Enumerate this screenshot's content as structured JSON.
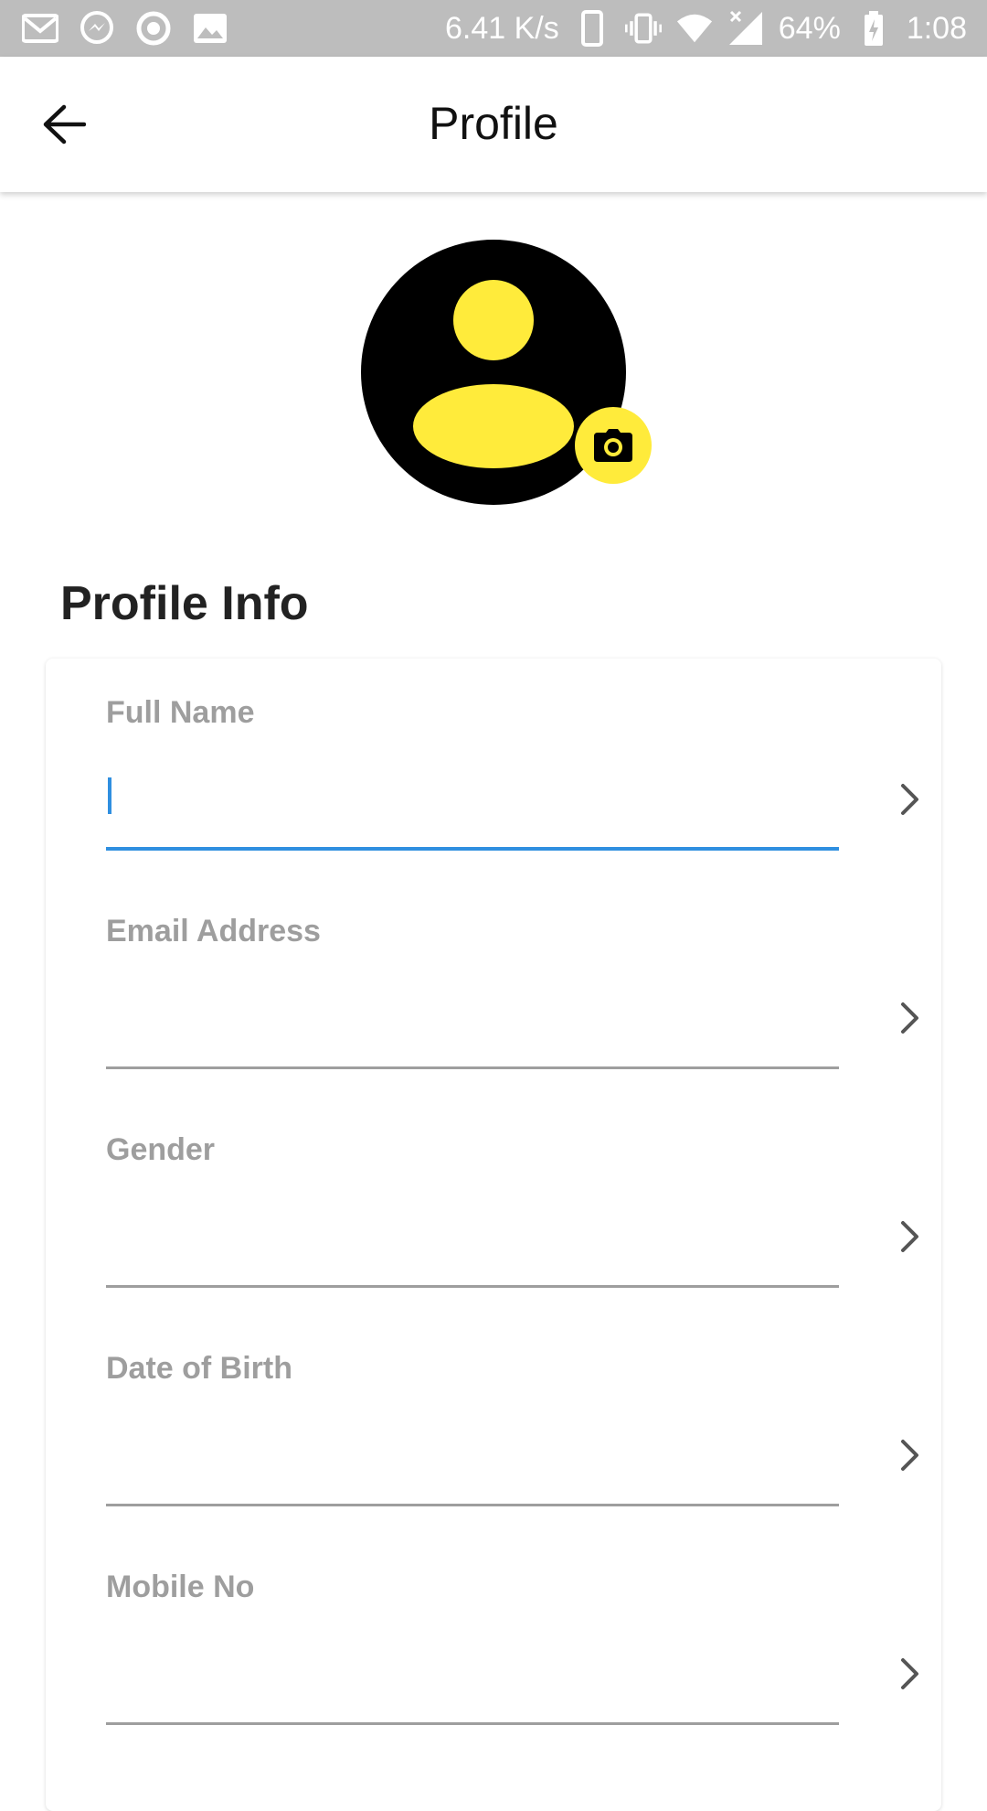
{
  "status_bar": {
    "speed": "6.41 K/s",
    "battery": "64%",
    "time": "1:08",
    "icons_left": [
      "gmail-icon",
      "messenger-icon",
      "circle-app-icon",
      "image-icon"
    ],
    "icons_right": [
      "phone-icon",
      "vibrate-icon",
      "wifi-icon",
      "signal-icon",
      "battery-charging-icon"
    ]
  },
  "appbar": {
    "title": "Profile"
  },
  "avatar": {
    "bg_color": "#000000",
    "accent_color": "#ffeb3b"
  },
  "section": {
    "title": "Profile Info"
  },
  "fields": [
    {
      "label": "Full Name",
      "value": "",
      "active": true
    },
    {
      "label": "Email Address",
      "value": "",
      "active": false
    },
    {
      "label": "Gender",
      "value": "",
      "active": false
    },
    {
      "label": "Date of Birth",
      "value": "",
      "active": false
    },
    {
      "label": "Mobile No",
      "value": "",
      "active": false
    }
  ],
  "colors": {
    "accent": "#2f8fe0",
    "label": "#9e9e9e",
    "status_bar": "#bdbdbd"
  }
}
